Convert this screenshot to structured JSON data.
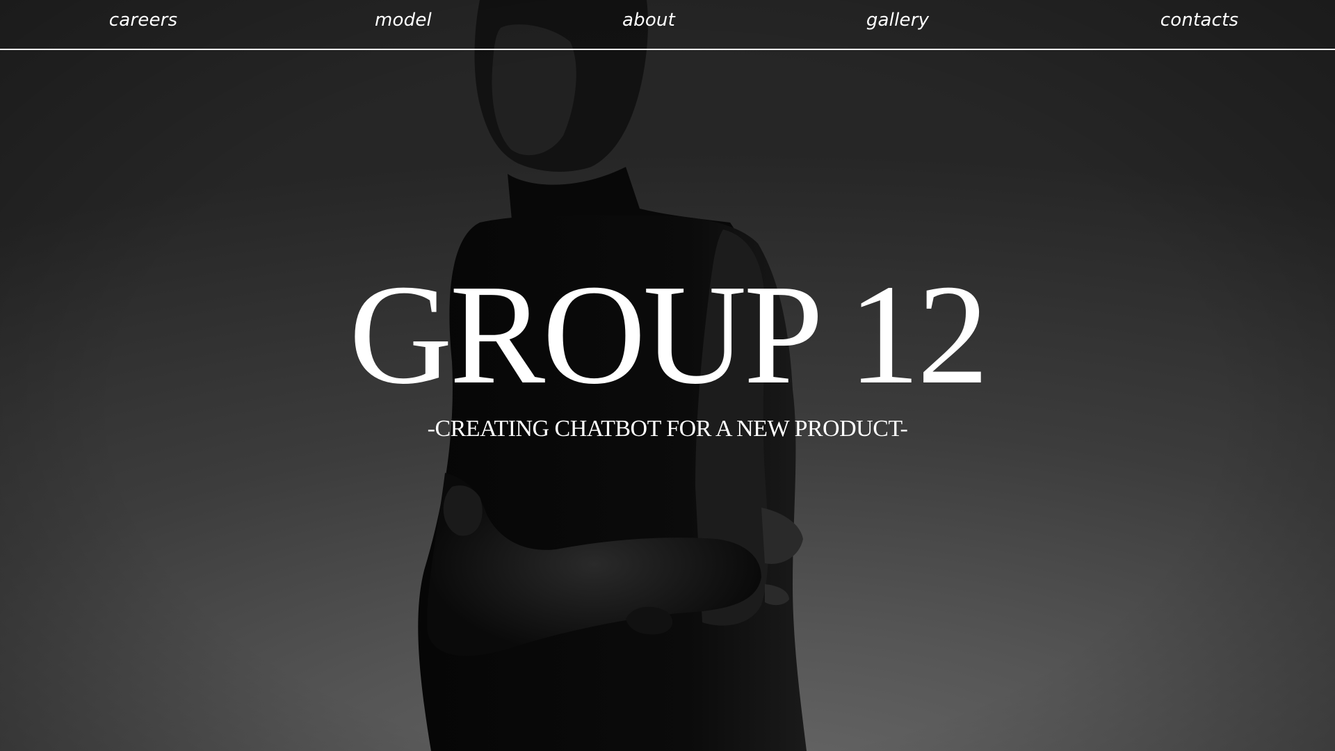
{
  "nav": {
    "items": [
      {
        "label": "careers"
      },
      {
        "label": "model"
      },
      {
        "label": "about"
      },
      {
        "label": "gallery"
      },
      {
        "label": "contacts"
      }
    ]
  },
  "hero": {
    "title": "GROUP 12",
    "subtitle": "-CREATING CHATBOT FOR A NEW PRODUCT-"
  },
  "colors": {
    "text": "#ffffff",
    "background": "#3a3a3a",
    "divider": "#f2f2f2"
  }
}
